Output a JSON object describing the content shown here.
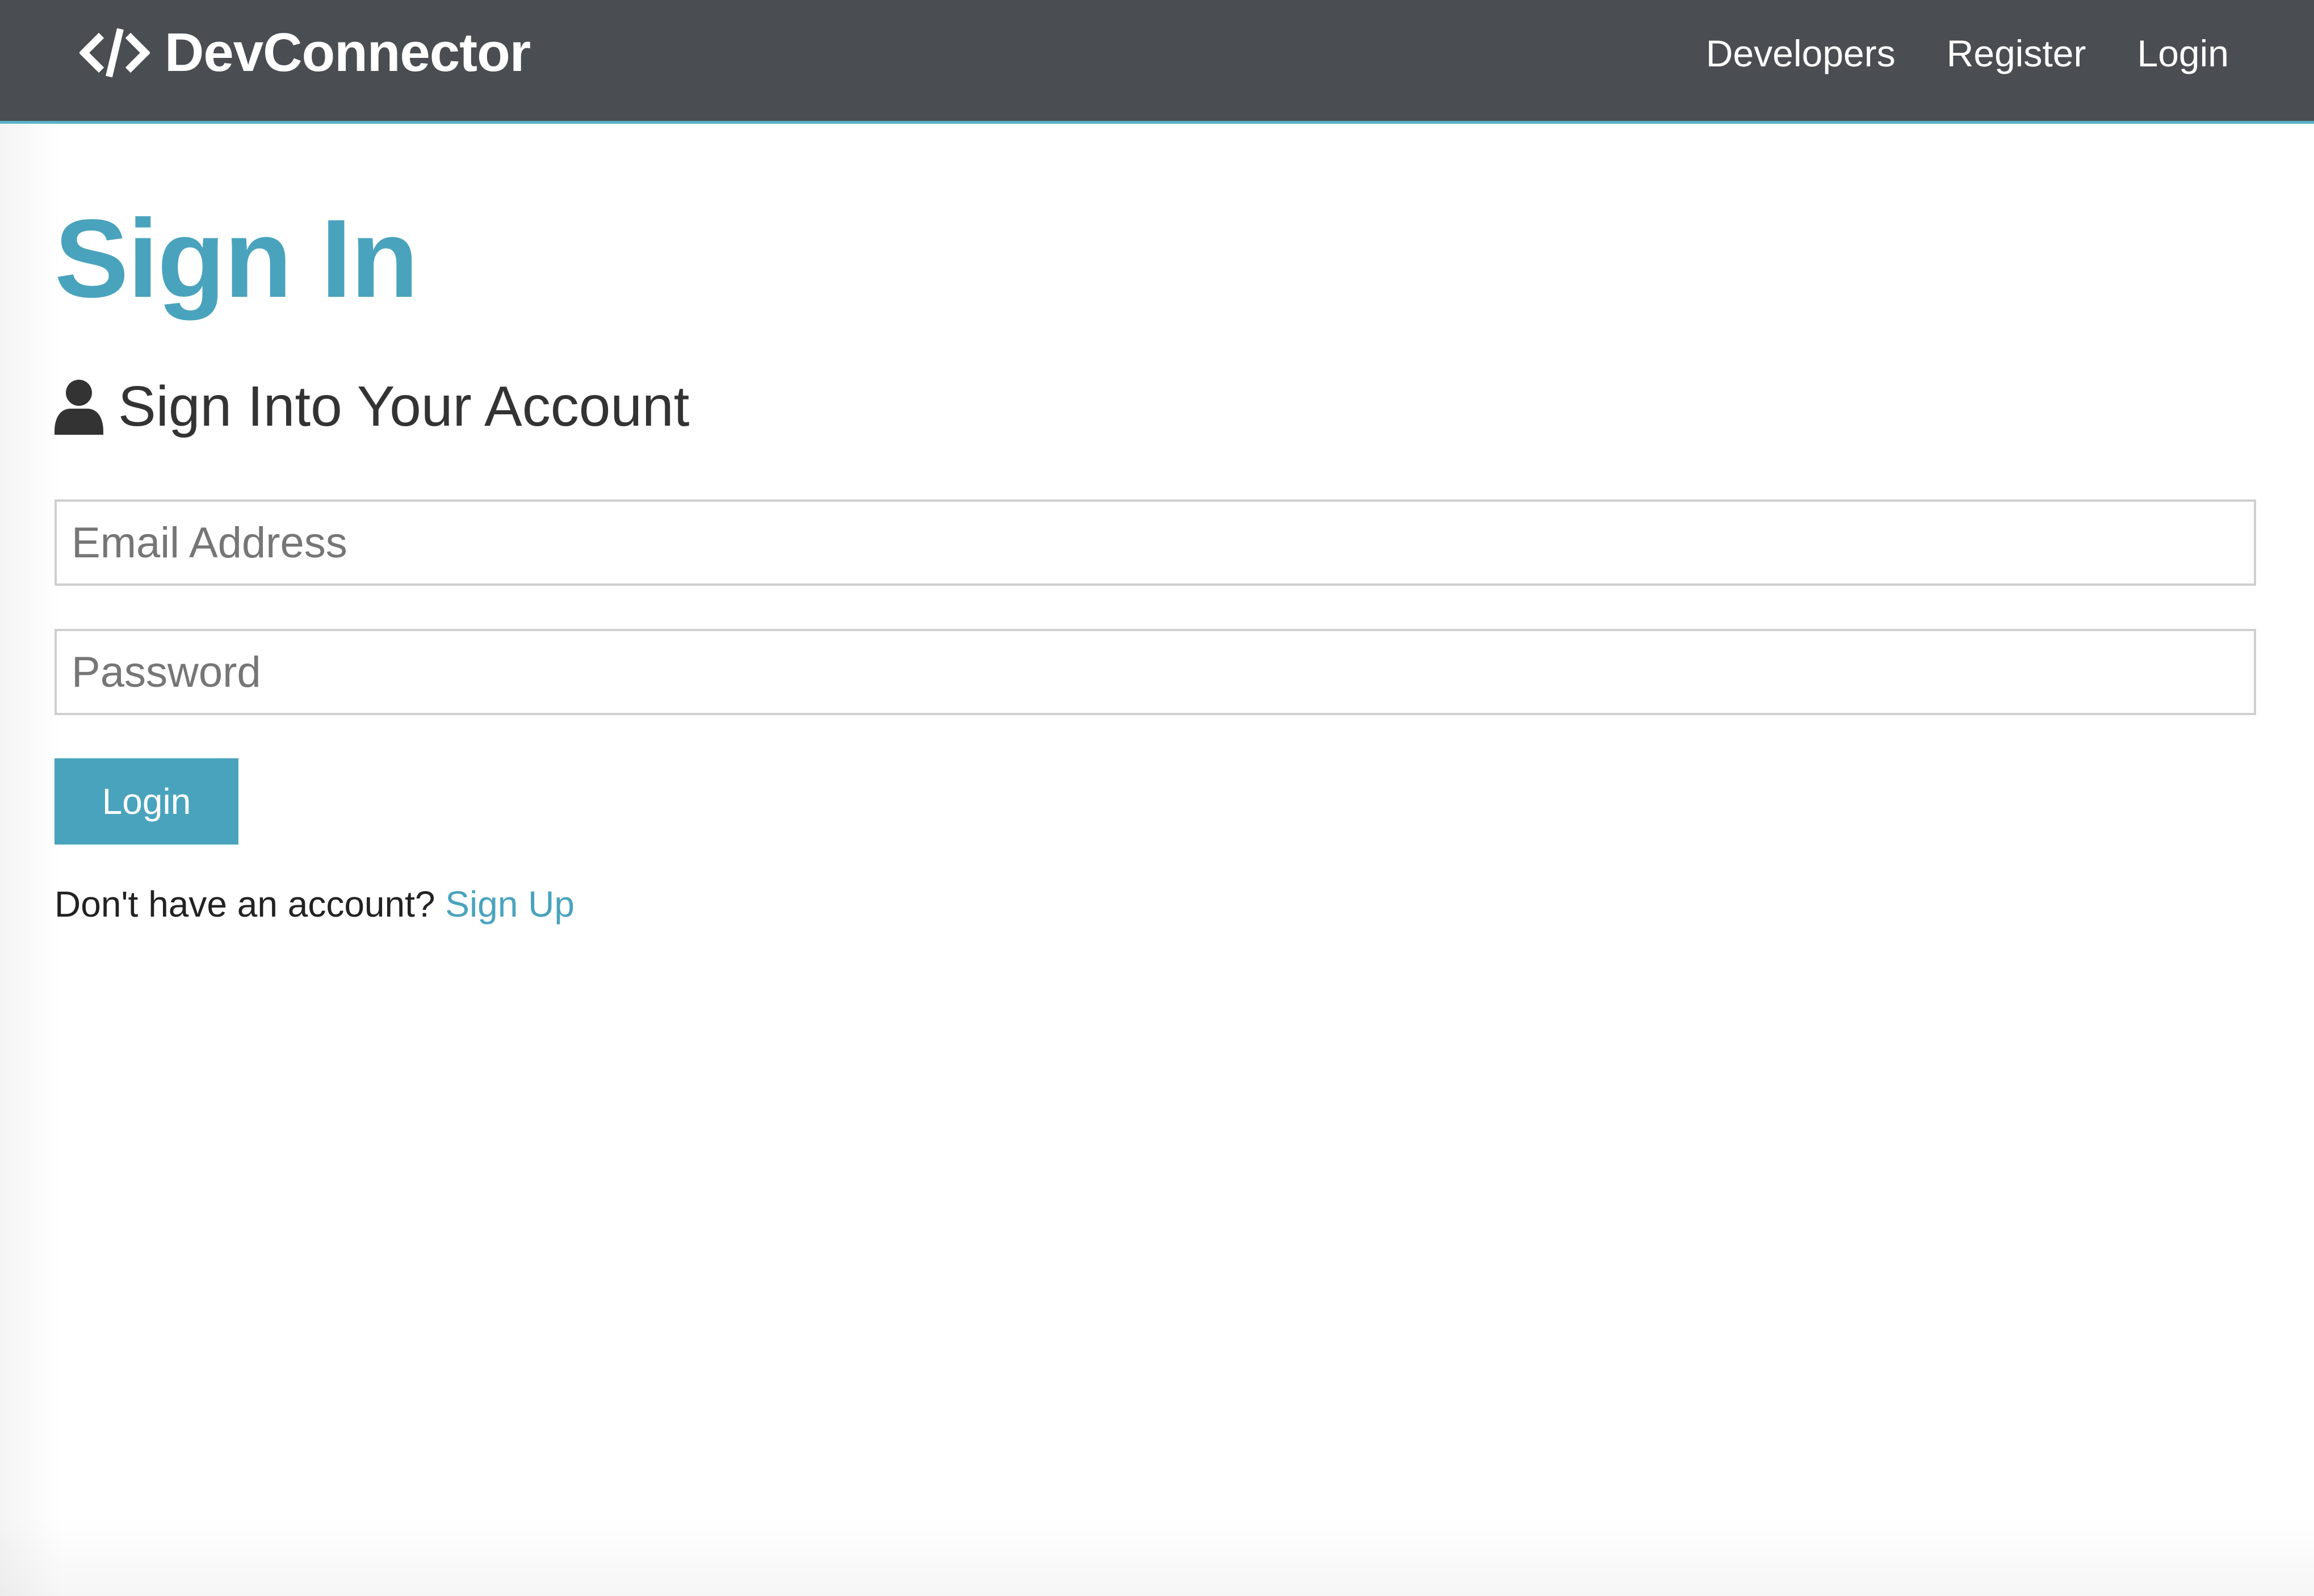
{
  "colors": {
    "accent": "#4aa3bd",
    "nav_background": "#4a4d52",
    "text": "#333333"
  },
  "navbar": {
    "brand": {
      "icon": "code-icon",
      "text": "DevConnector"
    },
    "links": [
      {
        "label": "Developers"
      },
      {
        "label": "Register"
      },
      {
        "label": "Login"
      }
    ]
  },
  "main": {
    "title": "Sign In",
    "lead": {
      "icon": "user-icon",
      "text": "Sign Into Your Account"
    },
    "form": {
      "email": {
        "placeholder": "Email Address",
        "value": ""
      },
      "password": {
        "placeholder": "Password",
        "value": ""
      },
      "submit_label": "Login"
    },
    "signup": {
      "prompt": "Don't have an account? ",
      "link_label": "Sign Up"
    }
  }
}
